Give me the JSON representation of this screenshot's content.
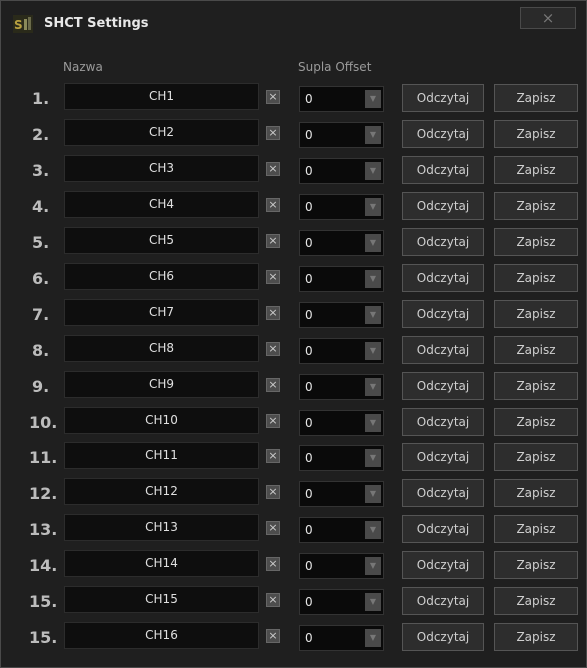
{
  "window": {
    "title": "SHCT Settings",
    "close_label": "×",
    "app_icon": "shct-app-icon"
  },
  "headers": {
    "name": "Nazwa",
    "offset": "Supla Offset"
  },
  "labels": {
    "clear": "×",
    "read": "Odczytaj",
    "save": "Zapisz"
  },
  "rows": [
    {
      "num": "1.",
      "name": "CH1",
      "offset": "0"
    },
    {
      "num": "2.",
      "name": "CH2",
      "offset": "0"
    },
    {
      "num": "3.",
      "name": "CH3",
      "offset": "0"
    },
    {
      "num": "4.",
      "name": "CH4",
      "offset": "0"
    },
    {
      "num": "5.",
      "name": "CH5",
      "offset": "0"
    },
    {
      "num": "6.",
      "name": "CH6",
      "offset": "0"
    },
    {
      "num": "7.",
      "name": "CH7",
      "offset": "0"
    },
    {
      "num": "8.",
      "name": "CH8",
      "offset": "0"
    },
    {
      "num": "9.",
      "name": "CH9",
      "offset": "0"
    },
    {
      "num": "10.",
      "name": "CH10",
      "offset": "0"
    },
    {
      "num": "11.",
      "name": "CH11",
      "offset": "0"
    },
    {
      "num": "12.",
      "name": "CH12",
      "offset": "0"
    },
    {
      "num": "13.",
      "name": "CH13",
      "offset": "0"
    },
    {
      "num": "14.",
      "name": "CH14",
      "offset": "0"
    },
    {
      "num": "15.",
      "name": "CH15",
      "offset": "0"
    },
    {
      "num": "15.",
      "name": "CH16",
      "offset": "0"
    }
  ],
  "colors": {
    "background": "#1f1f1f",
    "field": "#0e0e0e",
    "button": "#2d2d2d",
    "text": "#cfcfcf"
  }
}
